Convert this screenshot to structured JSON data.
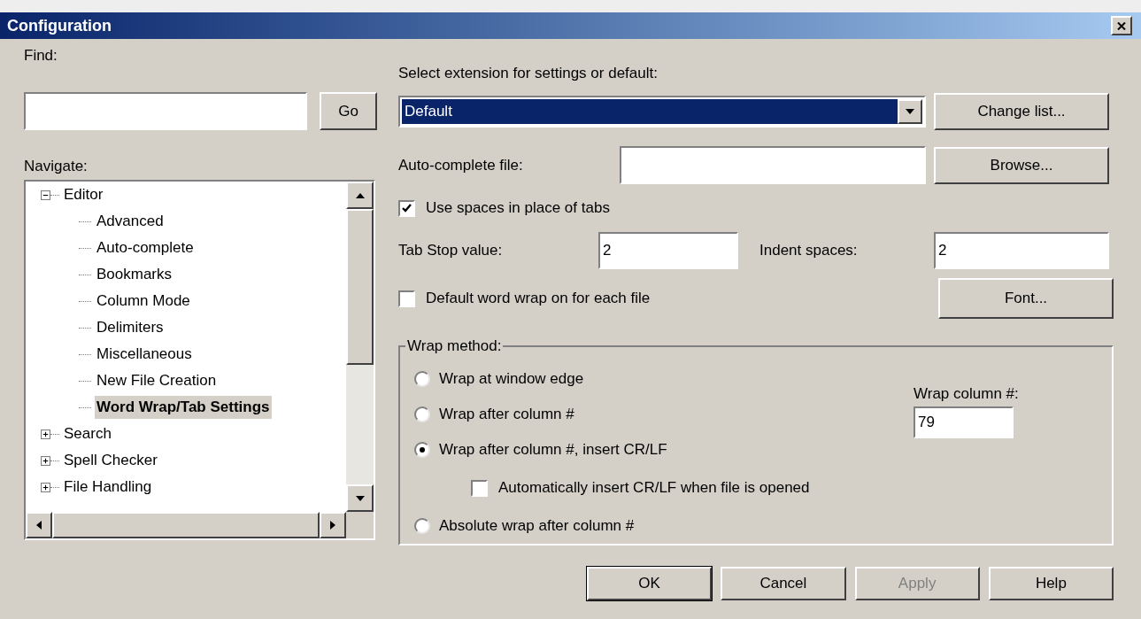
{
  "window": {
    "title": "Configuration"
  },
  "find": {
    "label": "Find:",
    "button": "Go"
  },
  "navigate": {
    "label": "Navigate:",
    "tree": [
      {
        "label": "Editor",
        "expanded": true,
        "selected": false,
        "children": [
          {
            "label": "Advanced",
            "selected": false
          },
          {
            "label": "Auto-complete",
            "selected": false
          },
          {
            "label": "Bookmarks",
            "selected": false
          },
          {
            "label": "Column Mode",
            "selected": false
          },
          {
            "label": "Delimiters",
            "selected": false
          },
          {
            "label": "Miscellaneous",
            "selected": false
          },
          {
            "label": "New File Creation",
            "selected": false
          },
          {
            "label": "Word Wrap/Tab Settings",
            "selected": true
          }
        ]
      },
      {
        "label": "Search",
        "expanded": false,
        "selected": false
      },
      {
        "label": "Spell Checker",
        "expanded": false,
        "selected": false
      },
      {
        "label": "File Handling",
        "expanded": false,
        "selected": false
      }
    ]
  },
  "extension": {
    "label": "Select extension for settings or default:",
    "value": "Default",
    "button": "Change list..."
  },
  "autocomplete": {
    "label": "Auto-complete file:",
    "button": "Browse..."
  },
  "use_spaces": {
    "label": "Use spaces in place of tabs",
    "checked": true
  },
  "tab_stop": {
    "label": "Tab Stop value:",
    "value": "2"
  },
  "indent": {
    "label": "Indent spaces:",
    "value": "2"
  },
  "word_wrap_default": {
    "label": "Default word wrap on for each file",
    "checked": false
  },
  "font_button": "Font...",
  "wrap_method": {
    "legend": "Wrap method:",
    "options": [
      {
        "kind": "radio",
        "label": "Wrap at window edge",
        "selected": false
      },
      {
        "kind": "radio",
        "label": "Wrap after column #",
        "selected": false
      },
      {
        "kind": "radio",
        "label": "Wrap after column #, insert CR/LF",
        "selected": true
      },
      {
        "kind": "checkbox",
        "label": "Automatically insert CR/LF when file is opened",
        "checked": false
      },
      {
        "kind": "radio",
        "label": "Absolute wrap after column #",
        "selected": false
      }
    ],
    "column_label": "Wrap column #:",
    "column_value": "79"
  },
  "buttons": [
    {
      "label": "OK",
      "default": true,
      "disabled": false
    },
    {
      "label": "Cancel",
      "default": false,
      "disabled": false
    },
    {
      "label": "Apply",
      "default": false,
      "disabled": true
    },
    {
      "label": "Help",
      "default": false,
      "disabled": false
    }
  ]
}
